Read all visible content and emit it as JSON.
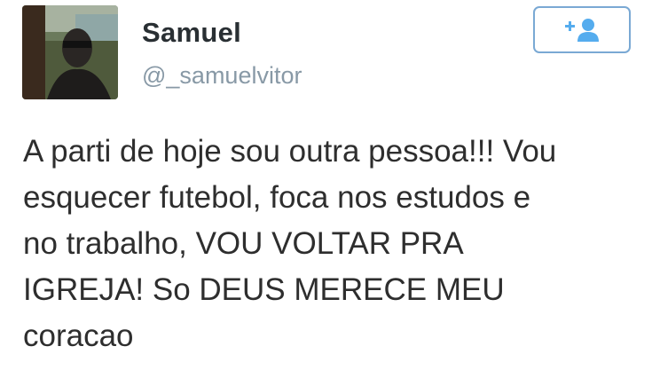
{
  "user": {
    "name": "Samuel",
    "handle": "@_samuelvitor"
  },
  "follow_button": {
    "icon": "add-user-icon",
    "accent": "#55acee"
  },
  "tweet": {
    "text": "A parti de hoje sou outra pessoa!!! Vou\nesquecer futebol, foca nos estudos e\nno trabalho, VOU VOLTAR PRA\nIGREJA! So DEUS MERECE MEU\ncoracao"
  }
}
